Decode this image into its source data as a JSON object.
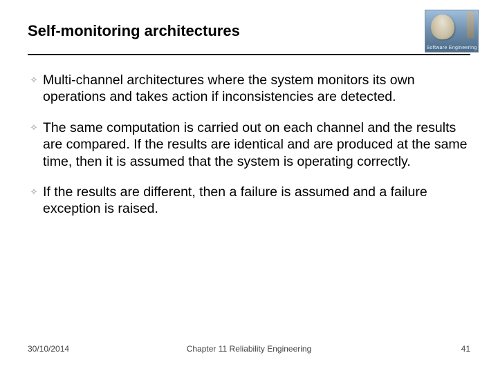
{
  "header": {
    "title": "Self-monitoring architectures",
    "logo_caption": "Software Engineering"
  },
  "bullets": [
    "Multi-channel architectures where the system monitors its own operations and takes action if inconsistencies are detected.",
    "The same computation is carried out on each channel and the results are compared. If the results are identical and are produced at the same time, then it is assumed that the system is operating correctly.",
    "If the results are different, then a failure is assumed and a failure exception is raised."
  ],
  "footer": {
    "date": "30/10/2014",
    "center": "Chapter 11 Reliability Engineering",
    "page": "41"
  }
}
